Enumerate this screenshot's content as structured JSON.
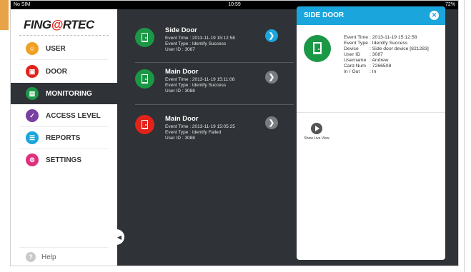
{
  "statusbar": {
    "carrier": "No SIM",
    "time": "10:59",
    "battery": "72%"
  },
  "logo": {
    "part1": "FING",
    "ring": "@",
    "part2": "RTEC"
  },
  "nav": [
    {
      "label": "USER",
      "icon": "user-icon",
      "color": "#f0a123"
    },
    {
      "label": "DOOR",
      "icon": "door-icon",
      "color": "#e2231a"
    },
    {
      "label": "MONITORING",
      "icon": "monitor-icon",
      "color": "#1b9846"
    },
    {
      "label": "ACCESS LEVEL",
      "icon": "checkbox-icon",
      "color": "#7a3fa0"
    },
    {
      "label": "REPORTS",
      "icon": "report-icon",
      "color": "#1aa5dc"
    },
    {
      "label": "SETTINGS",
      "icon": "gear-icon",
      "color": "#e0317c"
    }
  ],
  "help_label": "Help",
  "events": [
    {
      "name": "Side Door",
      "time_line": "Event Time : 2013-11-19    15:12:58",
      "type_line": "Event Type : Identify Success",
      "user_line": "User ID : 3087",
      "status_color": "#1b9846",
      "chev_color": "#1aa5dc"
    },
    {
      "name": "Main Door",
      "time_line": "Event Time : 2013-11-19    15:11:08",
      "type_line": "Event Type : Identify Success",
      "user_line": "User ID : 3088",
      "status_color": "#1b9846",
      "chev_color": "#7a7d80"
    },
    {
      "name": "Main Door",
      "time_line": "Event Time : 2013-11-19    15:05:25",
      "type_line": "Event Type : Identify Failed",
      "user_line": "User ID : 3088",
      "status_color": "#e2231a",
      "chev_color": "#7a7d80"
    }
  ],
  "detail": {
    "title": "SIDE DOOR",
    "close_glyph": "✕",
    "rows": [
      {
        "label": "Event Time",
        "value": ": 2013-11-19    15:12:58"
      },
      {
        "label": "Event Type",
        "value": ": Identify Success"
      },
      {
        "label": "Device",
        "value": ": Side door device [821283]"
      },
      {
        "label": "User ID",
        "value": ": 3087"
      },
      {
        "label": "Username",
        "value": ": Andrew"
      },
      {
        "label": "Card Num",
        "value": ": 7266508"
      },
      {
        "label": "In / Out",
        "value": ": In"
      }
    ],
    "live_view_label": "Show Live View"
  },
  "colors": {
    "accent_blue": "#1aa5dc",
    "dark_bg": "#2f3236",
    "success_green": "#1b9846",
    "fail_red": "#e2231a"
  }
}
